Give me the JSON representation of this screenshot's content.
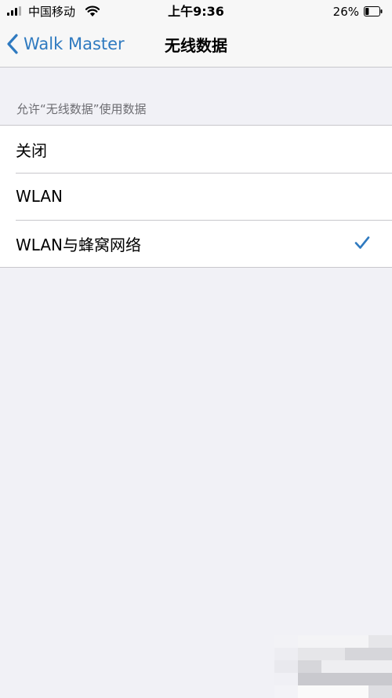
{
  "status_bar": {
    "carrier": "中国移动",
    "time": "上午9:36",
    "battery_percent": "26%",
    "signal_icon": "signal-bars-icon",
    "wifi_icon": "wifi-icon",
    "battery_icon": "battery-icon",
    "battery_level": 0.26
  },
  "nav": {
    "back_label": "Walk Master",
    "back_icon": "chevron-left-icon",
    "title": "无线数据"
  },
  "section": {
    "header": "允许“无线数据”使用数据"
  },
  "options": [
    {
      "label": "关闭",
      "selected": false
    },
    {
      "label": "WLAN",
      "selected": false
    },
    {
      "label": "WLAN与蜂窝网络",
      "selected": true
    }
  ],
  "colors": {
    "accent": "#2f7ac0",
    "background": "#f1f1f6",
    "separator": "#c8c7cc",
    "secondary_text": "#6d6d72"
  }
}
